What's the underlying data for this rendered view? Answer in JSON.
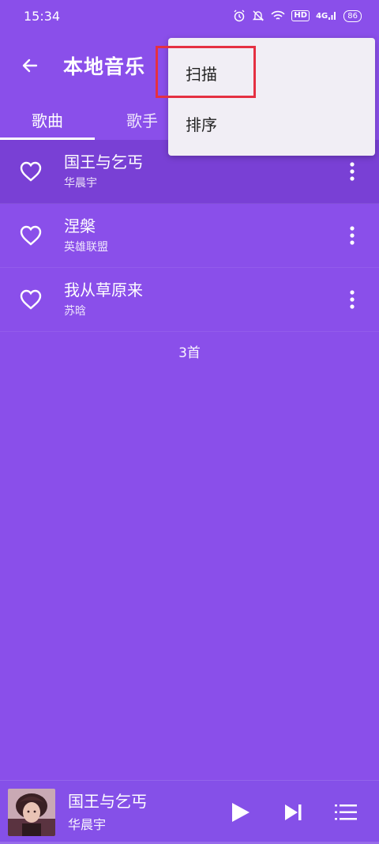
{
  "status_bar": {
    "time": "15:34",
    "hd_label": "HD",
    "network_label": "4G",
    "battery": "86"
  },
  "header": {
    "title": "本地音乐"
  },
  "tabs": [
    {
      "label": "歌曲",
      "active": true
    },
    {
      "label": "歌手",
      "active": false
    }
  ],
  "songs": [
    {
      "title": "国王与乞丐",
      "artist": "华晨宇"
    },
    {
      "title": "涅槃",
      "artist": "英雄联盟"
    },
    {
      "title": "我从草原来",
      "artist": "苏晗"
    }
  ],
  "song_count": "3首",
  "overflow_menu": {
    "items": [
      "扫描",
      "排序"
    ]
  },
  "player": {
    "title": "国王与乞丐",
    "artist": "华晨宇",
    "progress": 0.0
  },
  "colors": {
    "background": "#8A4FEA",
    "menu_background": "#F1EEF5",
    "highlight": "#E53042"
  }
}
